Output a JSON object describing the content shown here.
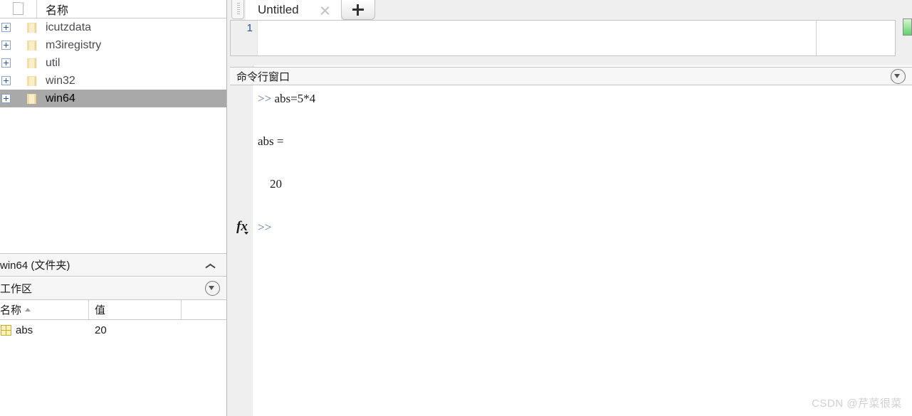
{
  "file_browser": {
    "columns": [
      {
        "icon": "document-icon",
        "label": ""
      },
      {
        "label": "名称"
      }
    ],
    "items": [
      {
        "label": "icutzdata",
        "icon": "folder-icon",
        "expander": "plus",
        "selected": false
      },
      {
        "label": "m3iregistry",
        "icon": "folder-icon",
        "expander": "plus",
        "selected": false
      },
      {
        "label": "util",
        "icon": "folder-icon",
        "expander": "plus",
        "selected": false
      },
      {
        "label": "win32",
        "icon": "folder-icon",
        "expander": "plus",
        "selected": false
      },
      {
        "label": "win64",
        "icon": "folder-icon",
        "expander": "plus",
        "selected": true
      }
    ]
  },
  "details_panel": {
    "title": "win64 (文件夹)",
    "collapse_icon": "chevron-up-icon"
  },
  "workspace": {
    "title": "工作区",
    "menu_icon": "circle-caret-down-icon",
    "columns": [
      "名称",
      "值",
      ""
    ],
    "sort_column": "名称",
    "sort_direction": "ascending",
    "rows": [
      {
        "icon": "matrix-icon",
        "name": "abs",
        "value": "20"
      }
    ]
  },
  "editor": {
    "grip_icon": "drag-grip-icon",
    "tabs": [
      {
        "label": "Untitled",
        "close_icon": "close-icon",
        "active": true
      }
    ],
    "new_tab_icon": "plus-icon",
    "line_numbers": [
      "1"
    ],
    "code": "",
    "health_indicator_color": "#5ed36a"
  },
  "command_window": {
    "title": "命令行窗口",
    "menu_icon": "circle-caret-down-icon",
    "lines": [
      ">> abs=5*4",
      "",
      "abs =",
      "",
      "    20",
      ""
    ],
    "prompt": ">>",
    "fx_label": "fx",
    "fx_caret_icon": "caret-down-icon"
  },
  "watermark": {
    "text": "CSDN @芹菜很菜"
  },
  "colors": {
    "selection": "#a9a9a9",
    "panel_bg": "#efefef",
    "header_bg": "#f7f7f7",
    "prompt_blue": "#5e7a9b",
    "linenum_blue": "#29568f",
    "green_ok": "#5ed36a"
  }
}
